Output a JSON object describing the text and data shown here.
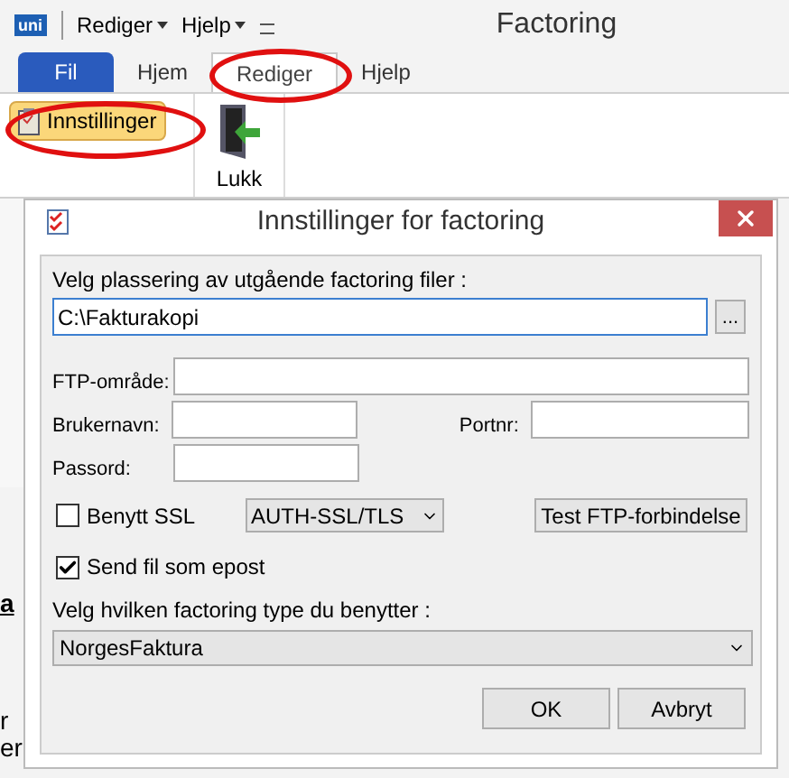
{
  "app": {
    "logo": "uni",
    "quick_menus": [
      {
        "label": "Rediger"
      },
      {
        "label": "Hjelp"
      }
    ],
    "title": "Factoring",
    "tabs": [
      {
        "label": "Fil",
        "kind": "file",
        "selected": false
      },
      {
        "label": "Hjem",
        "kind": "tab",
        "selected": false
      },
      {
        "label": "Rediger",
        "kind": "tab",
        "selected": true
      },
      {
        "label": "Hjelp",
        "kind": "tab",
        "selected": false
      }
    ],
    "ribbon": [
      {
        "label": "Innstillinger",
        "kind": "small",
        "highlighted": true
      },
      {
        "label": "Lukk",
        "kind": "large",
        "highlighted": false
      }
    ],
    "background_text": [
      {
        "text": "a",
        "kind": "link"
      },
      {
        "text": "r",
        "kind": "plain"
      },
      {
        "text": "er",
        "kind": "plain"
      }
    ]
  },
  "annotations": [
    {
      "kind": "ellipse"
    },
    {
      "kind": "ellipse"
    }
  ],
  "dialog": {
    "title": "Innstillinger for factoring",
    "folder_label": "Velg plassering av utgående factoring filer :",
    "folder_value": "C:\\Fakturakopi",
    "browse": "...",
    "ftp_area": {
      "label": "FTP-område:"
    },
    "username": {
      "label": "Brukernavn:"
    },
    "port": {
      "label": "Portnr:"
    },
    "password": {
      "label": "Passord:"
    },
    "ssl": {
      "label": "Benytt SSL",
      "checked": false
    },
    "ssl_mode": "AUTH-SSL/TLS",
    "test_button": "Test FTP-forbindelse",
    "email": {
      "label": "Send fil som epost",
      "checked": true
    },
    "type_label": "Velg hvilken factoring type du benytter :",
    "type_value": "NorgesFaktura",
    "buttons": [
      "OK",
      "Avbryt"
    ]
  }
}
